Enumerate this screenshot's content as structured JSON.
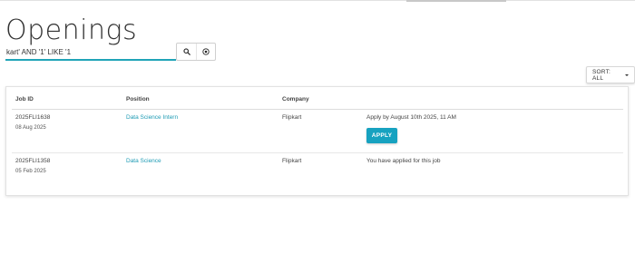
{
  "page": {
    "title": "Openings"
  },
  "search": {
    "value": "kart' AND '1' LIKE '1"
  },
  "sort": {
    "label": "SORT: ALL"
  },
  "table": {
    "headers": {
      "job_id": "Job ID",
      "position": "Position",
      "company": "Company"
    },
    "rows": [
      {
        "job_id": "2025FLI1638",
        "date": "08 Aug 2025",
        "position": "Data Science Intern",
        "company": "Flipkart",
        "status": "Apply by August 10th 2025, 11 AM",
        "action": "APPLY"
      },
      {
        "job_id": "2025FLI1358",
        "date": "05 Feb 2025",
        "position": "Data Science",
        "company": "Flipkart",
        "status": "You have applied for this job"
      }
    ]
  },
  "colors": {
    "accent": "#17a2c0",
    "link": "#1e9bb4"
  }
}
